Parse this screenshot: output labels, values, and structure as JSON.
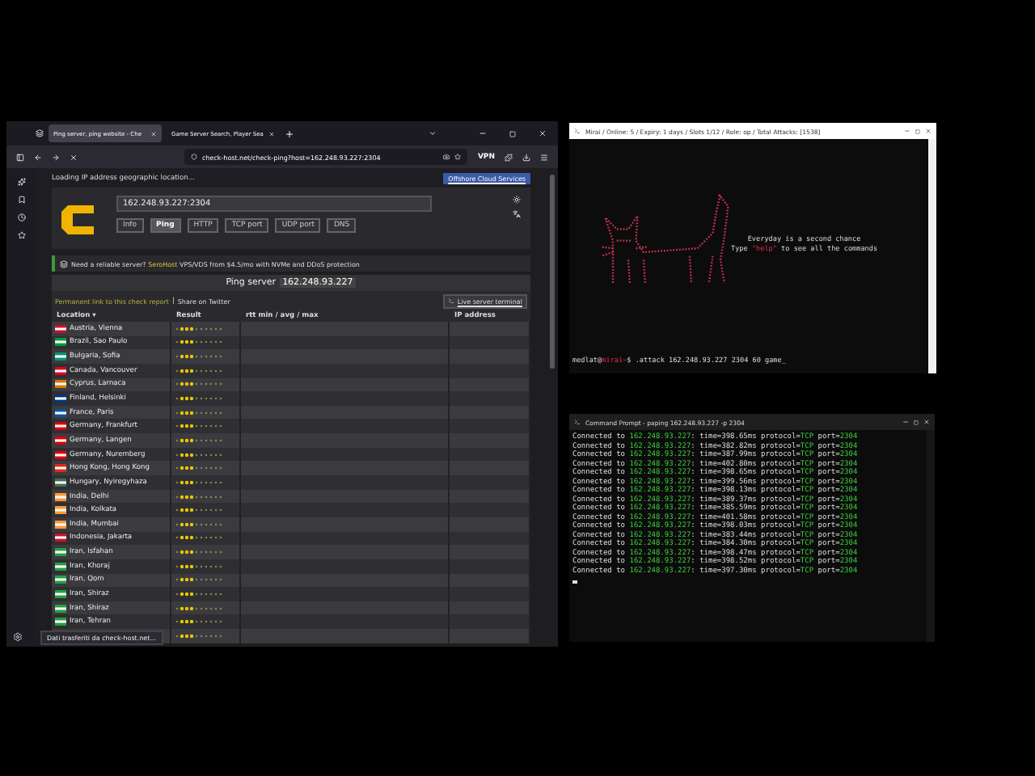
{
  "browser": {
    "tabs": [
      {
        "label": "Ping server, ping website - Che",
        "selected": true
      },
      {
        "label": "Game Server Search, Player Sea",
        "selected": false
      }
    ],
    "url": "check-host.net/check-ping?host=162.248.93.227:2304",
    "vpn": "VPN",
    "page": {
      "status": "Loading IP address geographic location...",
      "ad_button": "Offshore Cloud Services",
      "host_input": "162.248.93.227:2304",
      "check_buttons": [
        {
          "label": "Info",
          "selected": false
        },
        {
          "label": "Ping",
          "selected": true
        },
        {
          "label": "HTTP",
          "selected": false
        },
        {
          "label": "TCP port",
          "selected": false
        },
        {
          "label": "UDP port",
          "selected": false
        },
        {
          "label": "DNS",
          "selected": false
        }
      ],
      "banner": {
        "before": "Need a reliable server?",
        "brand": "SeroHost",
        "after": "VPS/VDS from $4.5/mo with NVMe and DDoS protection"
      },
      "heading": {
        "label": "Ping server",
        "host": "162.248.93.227"
      },
      "links": {
        "permalink": "Permanent link to this check report",
        "separator": "|",
        "share": "Share on Twitter"
      },
      "terminal_button": "Live server terminal",
      "columns": [
        "Location ▾",
        "Result",
        "rtt min / avg / max",
        "IP address"
      ],
      "rows": [
        {
          "location": "Austria, Vienna",
          "color": "#c8102e"
        },
        {
          "location": "Brazil, Sao Paulo",
          "color": "#009c3b"
        },
        {
          "location": "Bulgaria, Sofia",
          "color": "#00966e"
        },
        {
          "location": "Canada, Vancouver",
          "color": "#d80621"
        },
        {
          "location": "Cyprus, Larnaca",
          "color": "#d57800"
        },
        {
          "location": "Finland, Helsinki",
          "color": "#003580"
        },
        {
          "location": "France, Paris",
          "color": "#0055a4"
        },
        {
          "location": "Germany, Frankfurt",
          "color": "#dd0000"
        },
        {
          "location": "Germany, Langen",
          "color": "#dd0000"
        },
        {
          "location": "Germany, Nuremberg",
          "color": "#dd0000"
        },
        {
          "location": "Hong Kong, Hong Kong",
          "color": "#de2910"
        },
        {
          "location": "Hungary, Nyiregyhaza",
          "color": "#436f4d"
        },
        {
          "location": "India, Delhi",
          "color": "#ff9933"
        },
        {
          "location": "India, Kolkata",
          "color": "#ff9933"
        },
        {
          "location": "India, Mumbai",
          "color": "#ff9933"
        },
        {
          "location": "Indonesia, Jakarta",
          "color": "#ce1126"
        },
        {
          "location": "Iran, Isfahan",
          "color": "#239f40"
        },
        {
          "location": "Iran, Khoraj",
          "color": "#239f40"
        },
        {
          "location": "Iran, Qom",
          "color": "#239f40"
        },
        {
          "location": "Iran, Shiraz",
          "color": "#239f40"
        },
        {
          "location": "Iran, Shiraz",
          "color": "#239f40"
        },
        {
          "location": "Iran, Tehran",
          "color": "#239f40"
        },
        {}
      ],
      "status_tooltip": "Dati trasferiti da check-host.net..."
    }
  },
  "attack_terminal": {
    "title": "Mirai / Online: 5 / Expiry: 1 days / Slots 1/12 / Role: op / Total Attacks: [1538]",
    "motto": "Everyday is a second chance",
    "help_line": [
      "Type ",
      "\"help\"",
      " to see all the commands"
    ],
    "prompt": [
      "medlat@",
      "mirai~",
      "$ .attack 162.248.93.227 2304 60 game_"
    ]
  },
  "ping_terminal": {
    "title": "Command Prompt - paping  162.248.93.227 -p 2304",
    "lines": [
      [
        "Connected to ",
        "162.248.93.227",
        ": time=398.65ms protocol=",
        "TCP",
        " port=",
        "2304"
      ],
      [
        "Connected to ",
        "162.248.93.227",
        ": time=382.82ms protocol=",
        "TCP",
        " port=",
        "2304"
      ],
      [
        "Connected to ",
        "162.248.93.227",
        ": time=387.99ms protocol=",
        "TCP",
        " port=",
        "2304"
      ],
      [
        "Connected to ",
        "162.248.93.227",
        ": time=402.80ms protocol=",
        "TCP",
        " port=",
        "2304"
      ],
      [
        "Connected to ",
        "162.248.93.227",
        ": time=398.65ms protocol=",
        "TCP",
        " port=",
        "2304"
      ],
      [
        "Connected to ",
        "162.248.93.227",
        ": time=399.56ms protocol=",
        "TCP",
        " port=",
        "2304"
      ],
      [
        "Connected to ",
        "162.248.93.227",
        ": time=398.13ms protocol=",
        "TCP",
        " port=",
        "2304"
      ],
      [
        "Connected to ",
        "162.248.93.227",
        ": time=389.37ms protocol=",
        "TCP",
        " port=",
        "2304"
      ],
      [
        "Connected to ",
        "162.248.93.227",
        ": time=385.59ms protocol=",
        "TCP",
        " port=",
        "2304"
      ],
      [
        "Connected to ",
        "162.248.93.227",
        ": time=401.58ms protocol=",
        "TCP",
        " port=",
        "2304"
      ],
      [
        "Connected to ",
        "162.248.93.227",
        ": time=398.03ms protocol=",
        "TCP",
        " port=",
        "2304"
      ],
      [
        "Connected to ",
        "162.248.93.227",
        ": time=383.44ms protocol=",
        "TCP",
        " port=",
        "2304"
      ],
      [
        "Connected to ",
        "162.248.93.227",
        ": time=384.30ms protocol=",
        "TCP",
        " port=",
        "2304"
      ],
      [
        "Connected to ",
        "162.248.93.227",
        ": time=398.47ms protocol=",
        "TCP",
        " port=",
        "2304"
      ],
      [
        "Connected to ",
        "162.248.93.227",
        ": time=398.52ms protocol=",
        "TCP",
        " port=",
        "2304"
      ],
      [
        "Connected to ",
        "162.248.93.227",
        ": time=397.30ms protocol=",
        "TCP",
        " port=",
        "2304"
      ]
    ]
  }
}
